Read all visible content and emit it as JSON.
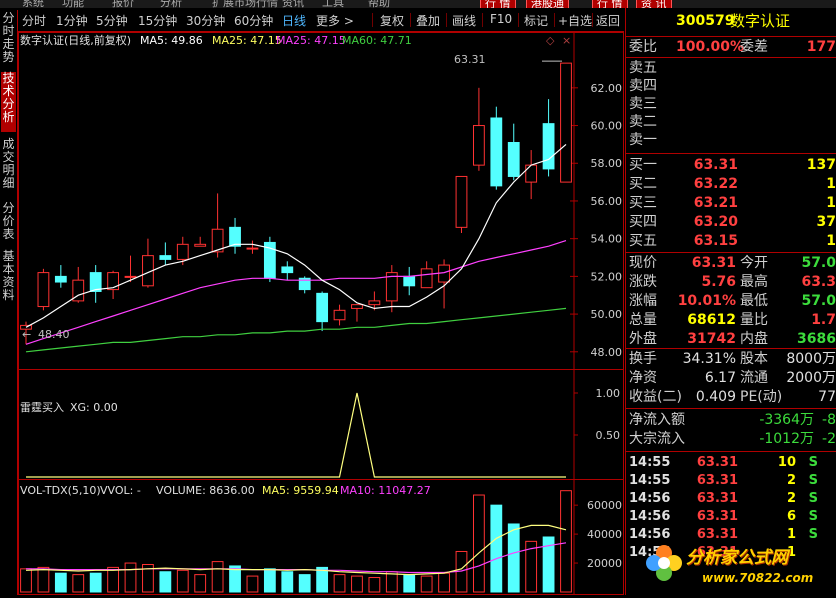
{
  "menubar": {
    "items": [
      "系统",
      "功能",
      "报价",
      "分析",
      "扩展市场行情",
      "资讯",
      "工具",
      "帮助"
    ],
    "right_items": [
      "行 情",
      "港股通",
      "行 情",
      "资 讯"
    ]
  },
  "toolbar": {
    "periods": [
      "分时",
      "1分钟",
      "5分钟",
      "15分钟",
      "30分钟",
      "60分钟",
      "日线",
      "更多 >"
    ],
    "active_period": "日线",
    "actions": [
      "复权",
      "叠加",
      "画线",
      "F10",
      "标记",
      "+自选",
      "返回"
    ]
  },
  "side_tabs": [
    {
      "label": "分时走势",
      "active": false
    },
    {
      "label": "技术分析",
      "active": true
    },
    {
      "label": "成交明细",
      "active": false
    },
    {
      "label": "分价表",
      "active": false
    },
    {
      "label": "基本资料",
      "active": false
    }
  ],
  "main_chart": {
    "title": "数字认证(日线,前复权)",
    "ma5_label": "MA5: 49.86",
    "ma25_label": "MA25: 47.15",
    "ma25b_label": "MA25: 47.15",
    "ma60_label": "MA60: 47.71",
    "high_marker": "63.31",
    "low_marker": "48.40",
    "price_ticks": [
      "62.00",
      "60.00",
      "58.00",
      "56.00",
      "54.00",
      "52.00",
      "50.00",
      "48.00"
    ],
    "colors": {
      "up": "#ff3232",
      "down": "#54ffff",
      "ma5": "#ffffff",
      "ma25": "#ff40ff",
      "ma60": "#40d040",
      "axis": "#b00000"
    }
  },
  "indicator": {
    "title": "雷霆买入",
    "xg_label": "XG: 0.00",
    "ticks": [
      "1.00",
      "0.50"
    ]
  },
  "volume": {
    "title": "VOL-TDX(5,10)",
    "vvol_label": "VVOL: -",
    "volume_label": "VOLUME: 8636.00",
    "ma5_label": "MA5: 9559.94",
    "ma10_label": "MA10: 11047.27",
    "ticks": [
      "60000",
      "40000",
      "20000"
    ]
  },
  "chart_data": {
    "type": "candlestick",
    "title": "数字认证(日线,前复权)",
    "candles": [
      {
        "o": 49.2,
        "c": 49.4,
        "h": 49.6,
        "l": 48.4,
        "v": 16000
      },
      {
        "o": 50.4,
        "c": 52.2,
        "h": 52.4,
        "l": 50.2,
        "v": 17000
      },
      {
        "o": 52.0,
        "c": 51.7,
        "h": 52.6,
        "l": 51.4,
        "v": 13000
      },
      {
        "o": 50.7,
        "c": 51.8,
        "h": 52.5,
        "l": 50.6,
        "v": 12000
      },
      {
        "o": 52.2,
        "c": 51.2,
        "h": 52.6,
        "l": 50.6,
        "v": 13000
      },
      {
        "o": 51.3,
        "c": 52.2,
        "h": 52.3,
        "l": 50.8,
        "v": 17000
      },
      {
        "o": 52.0,
        "c": 52.0,
        "h": 53.1,
        "l": 51.7,
        "v": 20000
      },
      {
        "o": 51.5,
        "c": 53.1,
        "h": 54.0,
        "l": 51.4,
        "v": 19000
      },
      {
        "o": 53.1,
        "c": 52.9,
        "h": 53.8,
        "l": 52.6,
        "v": 14000
      },
      {
        "o": 52.9,
        "c": 53.7,
        "h": 54.1,
        "l": 52.6,
        "v": 15000
      },
      {
        "o": 53.6,
        "c": 53.7,
        "h": 54.1,
        "l": 53.6,
        "v": 12000
      },
      {
        "o": 53.3,
        "c": 54.5,
        "h": 56.4,
        "l": 53.0,
        "v": 21000
      },
      {
        "o": 54.6,
        "c": 53.6,
        "h": 55.1,
        "l": 53.2,
        "v": 18000
      },
      {
        "o": 53.5,
        "c": 53.5,
        "h": 53.9,
        "l": 53.2,
        "v": 11000
      },
      {
        "o": 53.8,
        "c": 51.9,
        "h": 54.1,
        "l": 51.7,
        "v": 16000
      },
      {
        "o": 52.5,
        "c": 52.2,
        "h": 52.8,
        "l": 51.8,
        "v": 14000
      },
      {
        "o": 51.9,
        "c": 51.3,
        "h": 52.0,
        "l": 51.1,
        "v": 12000
      },
      {
        "o": 51.1,
        "c": 49.6,
        "h": 51.2,
        "l": 49.1,
        "v": 17000
      },
      {
        "o": 49.7,
        "c": 50.2,
        "h": 50.5,
        "l": 49.4,
        "v": 12000
      },
      {
        "o": 50.3,
        "c": 50.5,
        "h": 50.5,
        "l": 49.6,
        "v": 11000
      },
      {
        "o": 50.5,
        "c": 50.7,
        "h": 51.2,
        "l": 50.2,
        "v": 10000
      },
      {
        "o": 50.7,
        "c": 52.2,
        "h": 52.6,
        "l": 50.1,
        "v": 14000
      },
      {
        "o": 52.0,
        "c": 51.5,
        "h": 52.5,
        "l": 51.0,
        "v": 12000
      },
      {
        "o": 51.4,
        "c": 52.4,
        "h": 52.8,
        "l": 51.4,
        "v": 11000
      },
      {
        "o": 51.7,
        "c": 52.6,
        "h": 52.9,
        "l": 50.3,
        "v": 13000
      },
      {
        "o": 54.6,
        "c": 57.3,
        "h": 57.3,
        "l": 54.3,
        "v": 28000
      },
      {
        "o": 57.9,
        "c": 60.0,
        "h": 62.0,
        "l": 57.6,
        "v": 67000
      },
      {
        "o": 60.4,
        "c": 56.8,
        "h": 61.0,
        "l": 56.6,
        "v": 60000
      },
      {
        "o": 59.1,
        "c": 57.3,
        "h": 60.1,
        "l": 57.1,
        "v": 47000
      },
      {
        "o": 57.0,
        "c": 57.9,
        "h": 58.7,
        "l": 56.1,
        "v": 35000
      },
      {
        "o": 60.1,
        "c": 57.7,
        "h": 61.4,
        "l": 57.3,
        "v": 38000
      },
      {
        "o": 57.0,
        "c": 63.31,
        "h": 63.31,
        "l": 57.0,
        "v": 70000
      }
    ],
    "ma5": [
      49.3,
      49.8,
      50.4,
      51.0,
      51.3,
      51.4,
      51.8,
      52.2,
      52.6,
      52.8,
      53.1,
      53.4,
      53.7,
      53.7,
      53.5,
      53.2,
      52.6,
      51.8,
      51.3,
      50.6,
      50.3,
      50.4,
      50.4,
      50.9,
      51.5,
      52.4,
      54.0,
      55.9,
      57.0,
      57.9,
      58.2,
      59.0
    ],
    "ma25": [
      48.4,
      48.7,
      49.0,
      49.3,
      49.6,
      49.9,
      50.2,
      50.5,
      50.8,
      51.1,
      51.4,
      51.6,
      51.8,
      51.9,
      51.9,
      51.8,
      51.8,
      51.8,
      51.9,
      51.9,
      51.9,
      52.0,
      52.0,
      52.1,
      52.2,
      52.5,
      52.8,
      53.0,
      53.2,
      53.4,
      53.6,
      53.9
    ],
    "ma60": [
      48.0,
      48.1,
      48.2,
      48.3,
      48.4,
      48.5,
      48.5,
      48.6,
      48.7,
      48.8,
      48.8,
      48.9,
      48.9,
      49.0,
      49.0,
      49.1,
      49.1,
      49.2,
      49.2,
      49.3,
      49.3,
      49.4,
      49.5,
      49.5,
      49.6,
      49.7,
      49.8,
      49.9,
      50.0,
      50.1,
      50.2,
      50.3
    ],
    "xg": [
      0,
      0,
      0,
      0,
      0,
      0,
      0,
      0,
      0,
      0,
      0,
      0,
      0,
      0,
      0,
      0,
      0,
      0,
      0,
      1,
      0,
      0,
      0,
      0,
      0,
      0,
      0,
      0,
      0,
      0,
      0,
      0
    ],
    "vol_ma5": [
      15000,
      15500,
      15000,
      14500,
      15000,
      15000,
      15500,
      16000,
      16500,
      16000,
      15500,
      16000,
      15500,
      15500,
      15500,
      15000,
      15500,
      15000,
      14000,
      13500,
      13000,
      12500,
      12000,
      12500,
      13000,
      16000,
      27000,
      37000,
      43000,
      46000,
      46000,
      43000
    ],
    "vol_ma10": [
      16000,
      16000,
      15500,
      15500,
      15500,
      15500,
      15500,
      16000,
      16000,
      16000,
      16000,
      16000,
      16000,
      15500,
      15500,
      15500,
      15500,
      15000,
      15000,
      14500,
      14000,
      14000,
      13500,
      13500,
      13500,
      14500,
      18000,
      23000,
      27000,
      30000,
      32000,
      34000
    ],
    "ylim_price": [
      47.3,
      63.9
    ],
    "ylim_volume": [
      0,
      76000
    ],
    "ylim_indicator": [
      0,
      1.25
    ]
  },
  "quote": {
    "code": "300579",
    "name": "数字认证",
    "weibi_label": "委比",
    "weibi_value": "100.00%",
    "weicha_label": "委差",
    "weicha_value": "177",
    "sell_levels": [
      "卖五",
      "卖四",
      "卖三",
      "卖二",
      "卖一"
    ],
    "buy_levels": [
      {
        "label": "买一",
        "price": "63.31",
        "vol": "137"
      },
      {
        "label": "买二",
        "price": "63.22",
        "vol": "1"
      },
      {
        "label": "买三",
        "price": "63.21",
        "vol": "1"
      },
      {
        "label": "买四",
        "price": "63.20",
        "vol": "37"
      },
      {
        "label": "买五",
        "price": "63.15",
        "vol": "1"
      }
    ],
    "stats": [
      {
        "l1": "现价",
        "v1": "63.31",
        "c1": "red",
        "l2": "今开",
        "v2": "57.0",
        "c2": "green"
      },
      {
        "l1": "涨跌",
        "v1": "5.76",
        "c1": "red",
        "l2": "最高",
        "v2": "63.3",
        "c2": "red"
      },
      {
        "l1": "涨幅",
        "v1": "10.01%",
        "c1": "red",
        "l2": "最低",
        "v2": "57.0",
        "c2": "green"
      },
      {
        "l1": "总量",
        "v1": "68612",
        "c1": "yellow",
        "l2": "量比",
        "v2": "1.7",
        "c2": "red"
      },
      {
        "l1": "外盘",
        "v1": "31742",
        "c1": "red",
        "l2": "内盘",
        "v2": "3686",
        "c2": "green"
      }
    ],
    "stats2": [
      {
        "l1": "换手",
        "v1": "34.31%",
        "l2": "股本",
        "v2": "8000万"
      },
      {
        "l1": "净资",
        "v1": "6.17",
        "l2": "流通",
        "v2": "2000万"
      },
      {
        "l1": "收益(二)",
        "v1": "0.409",
        "l2": "PE(动)",
        "v2": "77"
      }
    ],
    "flows": [
      {
        "label": "净流入额",
        "value": "-3364万",
        "extra": "-8"
      },
      {
        "label": "大宗流入",
        "value": "-1012万",
        "extra": "-2"
      }
    ],
    "ticks": [
      {
        "time": "14:55",
        "price": "63.31",
        "vol": "10",
        "side": "S"
      },
      {
        "time": "14:55",
        "price": "63.31",
        "vol": "2",
        "side": "S"
      },
      {
        "time": "14:56",
        "price": "63.31",
        "vol": "2",
        "side": "S"
      },
      {
        "time": "14:56",
        "price": "63.31",
        "vol": "6",
        "side": "S"
      },
      {
        "time": "14:56",
        "price": "63.31",
        "vol": "1",
        "side": "S"
      },
      {
        "time": "14:56",
        "price": "63.31",
        "vol": "1",
        "side": ""
      }
    ]
  },
  "watermark": {
    "brand": "分析家公式网",
    "url": "www.70822.com"
  }
}
